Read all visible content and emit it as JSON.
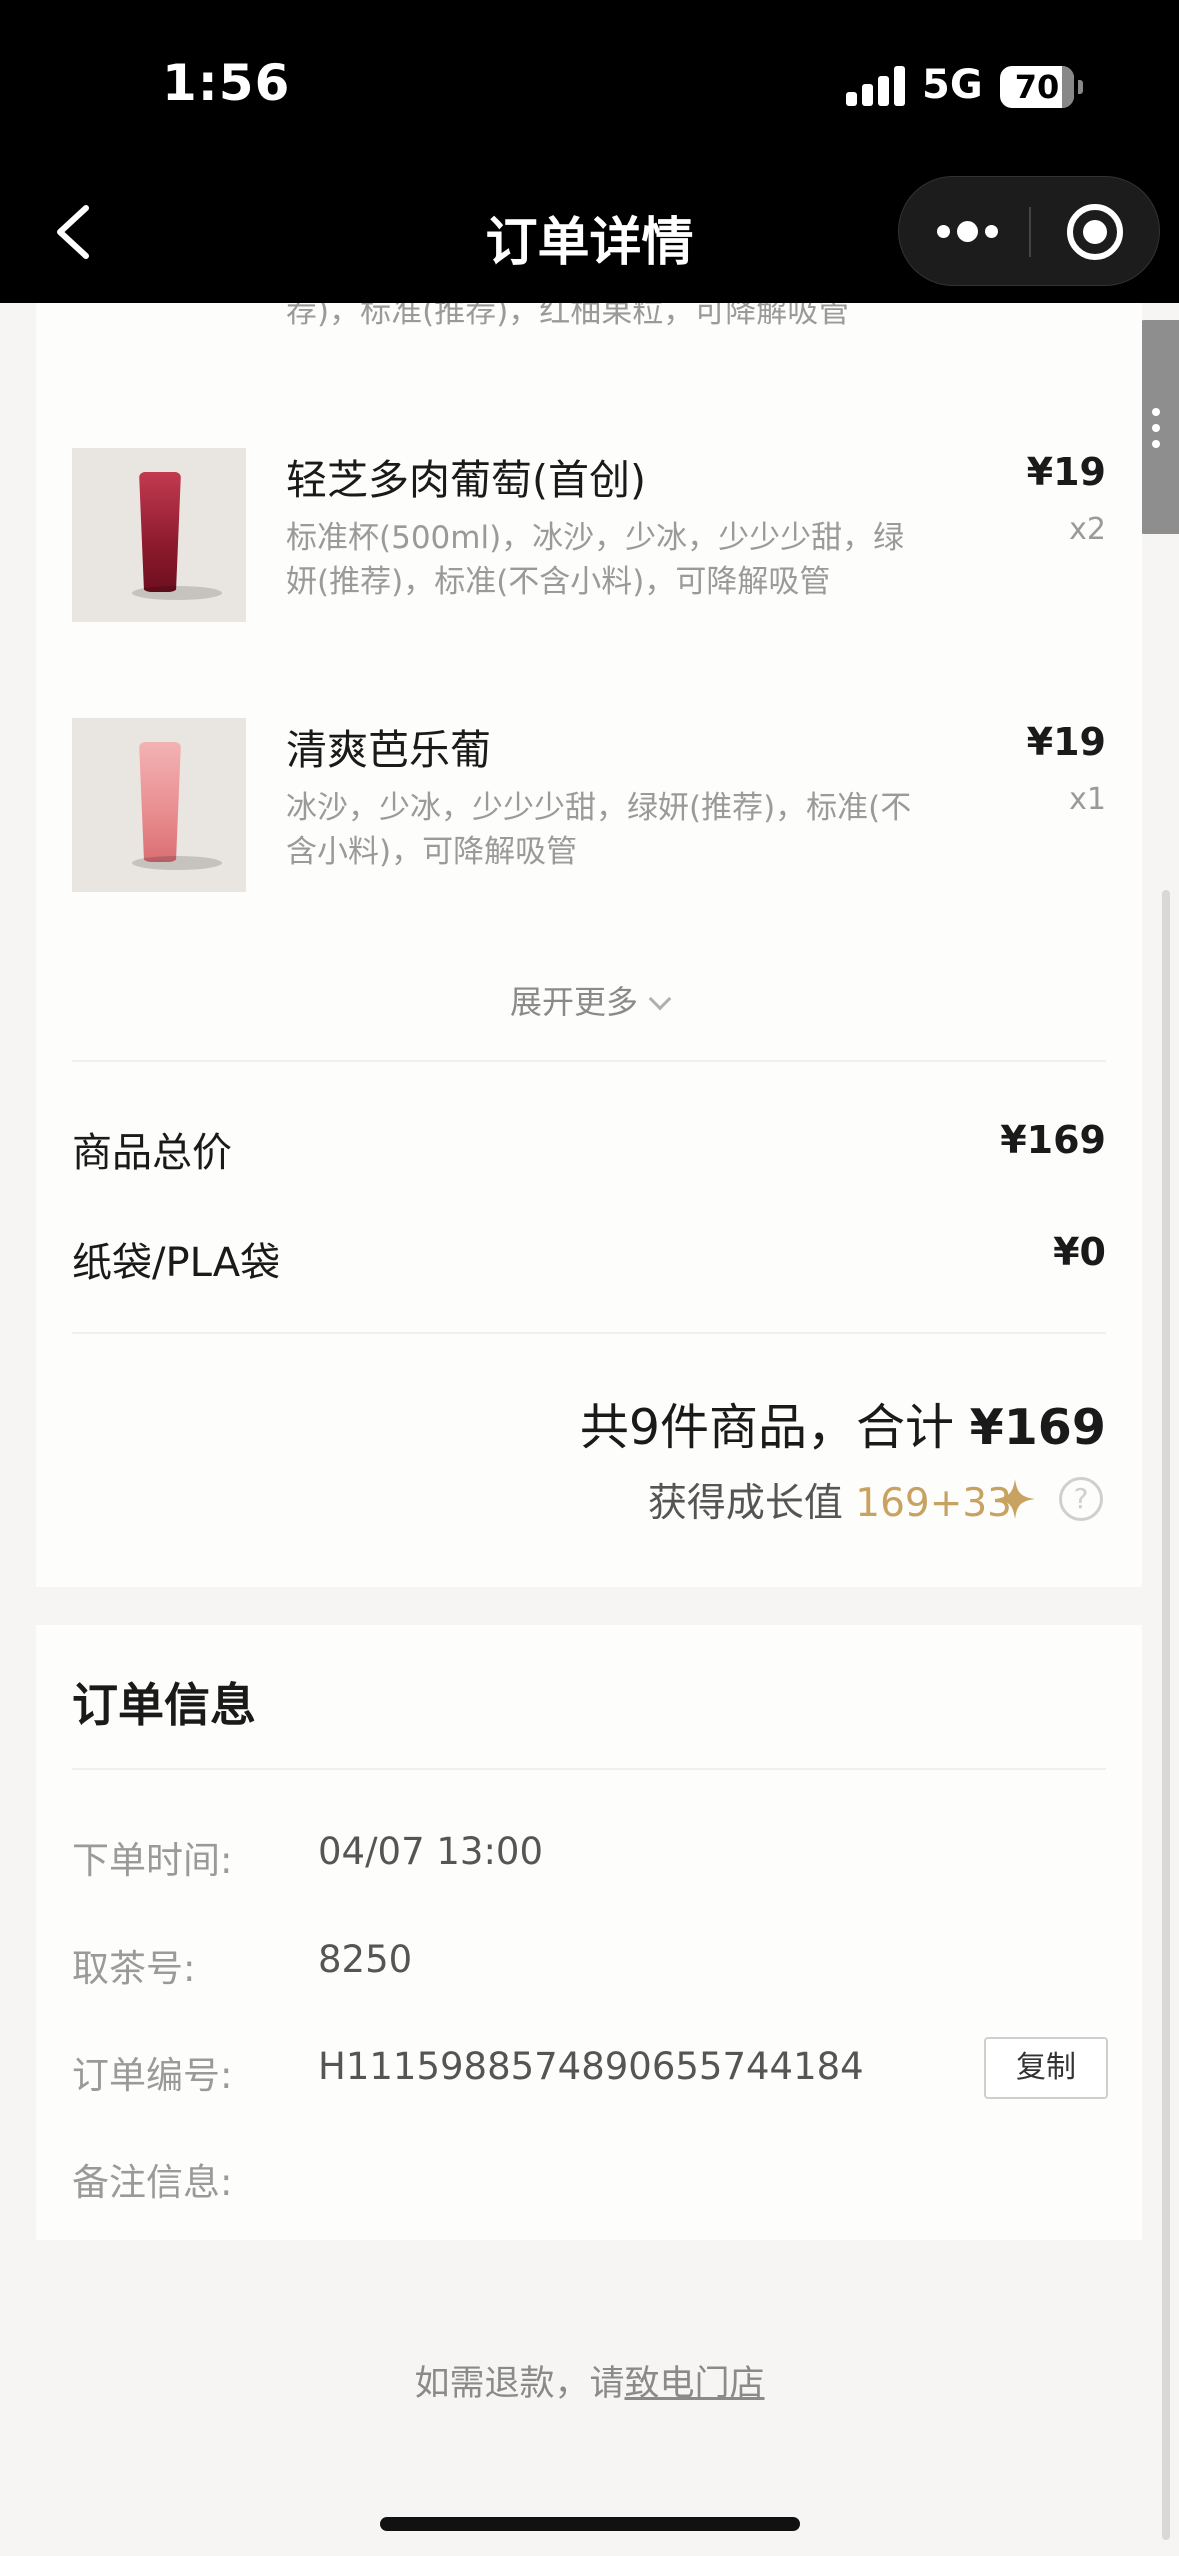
{
  "status_bar": {
    "time": "1:56",
    "network": "5G",
    "battery": "70"
  },
  "nav": {
    "title": "订单详情"
  },
  "items": [
    {
      "name": "",
      "desc": "荐)，标准(推荐)，红柚果粒，可降解吸管",
      "price": "",
      "qty": "",
      "cup_color": "#e6a42a"
    },
    {
      "name": "轻芝多肉葡萄(首创)",
      "desc": "标准杯(500ml)，冰沙，少冰，少少少甜，绿妍(推荐)，标准(不含小料)，可降解吸管",
      "price": "¥19",
      "qty": "x2",
      "cup_color": "#8e1a2e"
    },
    {
      "name": "清爽芭乐葡",
      "desc": "冰沙，少冰，少少少甜，绿妍(推荐)，标准(不含小料)，可降解吸管",
      "price": "¥19",
      "qty": "x1",
      "cup_color": "#e98c8f"
    }
  ],
  "expand_more": "展开更多",
  "summary": {
    "goods_total_label": "商品总价",
    "goods_total_value": "¥169",
    "bag_label": "纸袋/PLA袋",
    "bag_value": "¥0",
    "total_text": "共9件商品，合计",
    "total_value": "¥169",
    "growth_label": "获得成长值",
    "growth_value": "169+33"
  },
  "order_info": {
    "title": "订单信息",
    "time_label": "下单时间:",
    "time_value": "04/07 13:00",
    "pickup_label": "取茶号:",
    "pickup_value": "8250",
    "order_no_label": "订单编号:",
    "order_no_value": "H1115988574890655744184",
    "copy_label": "复制",
    "note_label": "备注信息:",
    "note_value": ""
  },
  "refund": {
    "prefix": "如需退款，请",
    "link": "致电门店"
  },
  "colors": {
    "gold": "#c8a261",
    "background": "#f6f5f3",
    "card": "#fdfdfc"
  }
}
